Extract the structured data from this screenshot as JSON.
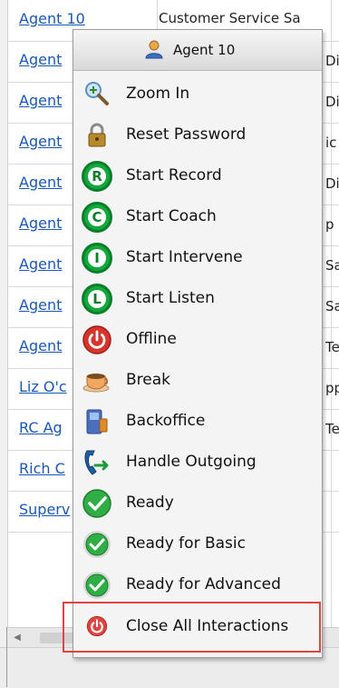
{
  "grid": {
    "rows": [
      {
        "name": "Agent 10",
        "desc": "Customer Service Sa",
        "right": ""
      },
      {
        "name": "Agent",
        "desc": "",
        "right": "Di"
      },
      {
        "name": "Agent",
        "desc": "",
        "right": "Di"
      },
      {
        "name": "Agent",
        "desc": "",
        "right": "ic"
      },
      {
        "name": "Agent",
        "desc": "",
        "right": "Di"
      },
      {
        "name": "Agent",
        "desc": "",
        "right": "p"
      },
      {
        "name": "Agent",
        "desc": "",
        "right": "Sa"
      },
      {
        "name": "Agent",
        "desc": "",
        "right": "Sa"
      },
      {
        "name": "Agent",
        "desc": "",
        "right": "Te"
      },
      {
        "name": "Liz O'c",
        "desc": "",
        "right": "pp"
      },
      {
        "name": "RC Ag",
        "desc": "",
        "right": "Te"
      },
      {
        "name": "Rich C",
        "desc": "",
        "right": ""
      },
      {
        "name": "Superv",
        "desc": "",
        "right": ""
      }
    ]
  },
  "menu": {
    "header_label": "Agent 10",
    "items": [
      {
        "label": "Zoom In",
        "icon": "zoom-in-icon"
      },
      {
        "label": "Reset Password",
        "icon": "lock-icon"
      },
      {
        "label": "Start Record",
        "icon": "record-icon"
      },
      {
        "label": "Start Coach",
        "icon": "coach-icon"
      },
      {
        "label": "Start Intervene",
        "icon": "intervene-icon"
      },
      {
        "label": "Start Listen",
        "icon": "listen-icon"
      },
      {
        "label": "Offline",
        "icon": "power-icon"
      },
      {
        "label": "Break",
        "icon": "coffee-cup-icon"
      },
      {
        "label": "Backoffice",
        "icon": "backoffice-icon"
      },
      {
        "label": "Handle Outgoing",
        "icon": "phone-outgoing-icon"
      },
      {
        "label": "Ready",
        "icon": "checkmark-icon"
      },
      {
        "label": "Ready for Basic",
        "icon": "checkmark-icon"
      },
      {
        "label": "Ready for Advanced",
        "icon": "checkmark-icon"
      },
      {
        "label": "Close All Interactions",
        "icon": "close-all-power-icon"
      }
    ]
  },
  "colors": {
    "link": "#1a57b8",
    "green": "#12a93b",
    "power_red": "#d9342b",
    "highlight": "#e0443e"
  }
}
